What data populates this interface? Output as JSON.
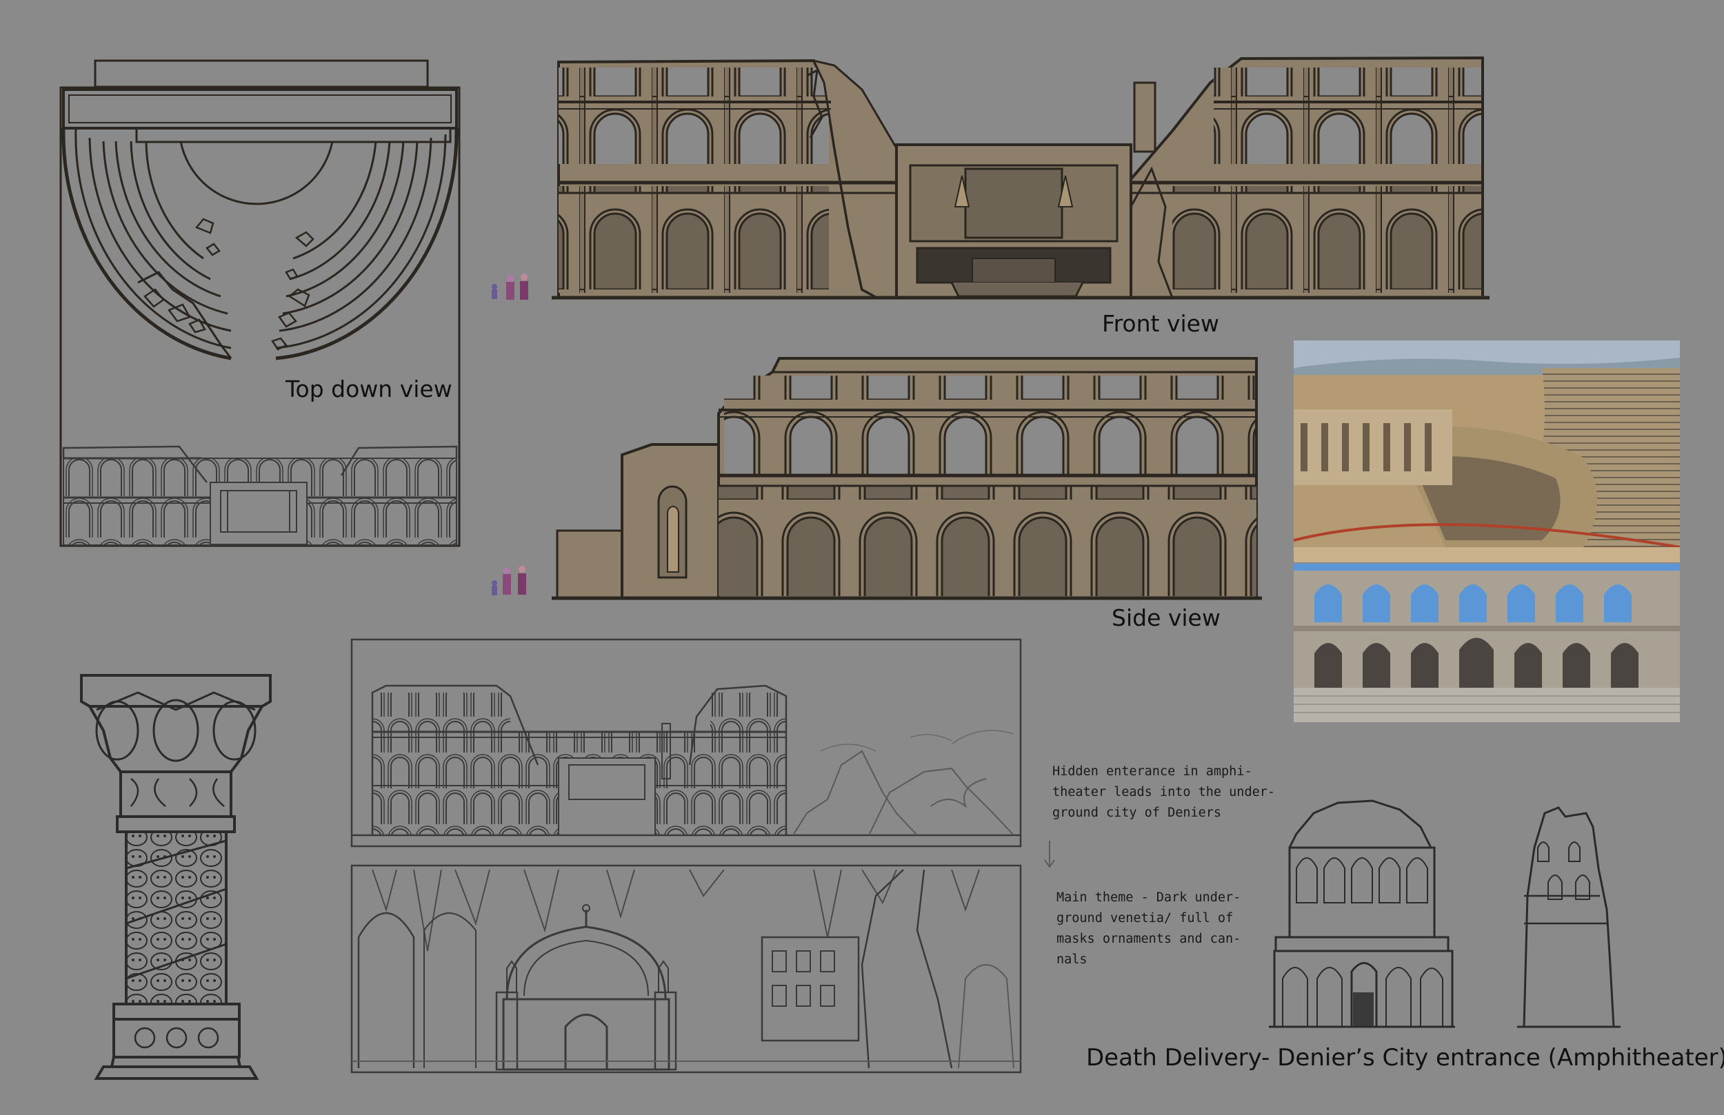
{
  "labels": {
    "top_down": "Top down view",
    "front": "Front view",
    "side": "Side view"
  },
  "notes": {
    "hidden_entrance": "Hidden enterance in amphi-\ntheater leads into the under-\nground city of Deniers",
    "main_theme": "Main theme - Dark under-\nground venetia/ full of\nmasks ornaments and can-\nnals"
  },
  "title": "Death Delivery- Denier’s City entrance (Amphitheater)",
  "colors": {
    "background": "#8a8a8a",
    "stone": "#8d7f69",
    "stone_dark": "#6e6455",
    "line": "#2b2620",
    "sketch": "#3a3a3a"
  }
}
